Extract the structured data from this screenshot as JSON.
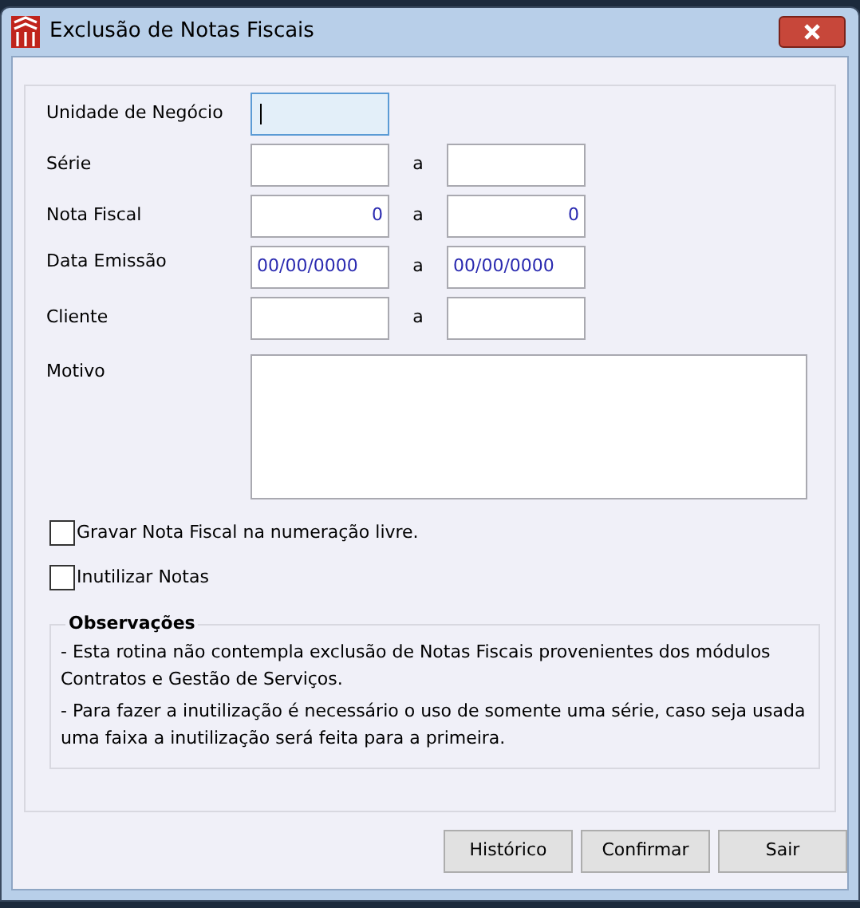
{
  "window": {
    "title": "Exclusão de Notas Fiscais"
  },
  "fields": [
    {
      "label": "Unidade de Negócio",
      "kind": "single",
      "focused": true
    },
    {
      "label": "Série",
      "kind": "range",
      "focused": false,
      "separator": "a"
    },
    {
      "label": "Nota Fiscal",
      "kind": "numeric",
      "focused": false,
      "from": "0",
      "separator": "a",
      "to": "0"
    },
    {
      "label": "Data Emissão",
      "kind": "date",
      "focused": false,
      "from": "00/00/0000",
      "separator": "a",
      "to": "00/00/0000"
    },
    {
      "label": "Cliente",
      "kind": "range",
      "focused": false,
      "separator": "a"
    }
  ],
  "motivo": {
    "label": "Motivo"
  },
  "checkboxes": [
    {
      "label": "Gravar Nota Fiscal na numeração livre.",
      "checked": false
    },
    {
      "label": "Inutilizar Notas",
      "checked": false
    }
  ],
  "notes": {
    "title": "Observações",
    "items": [
      "- Esta rotina não contempla exclusão de Notas Fiscais provenientes dos módulos Contratos e Gestão de Serviços.",
      "- Para fazer a inutilização é necessário o uso de somente uma série, caso seja usada uma faixa a inutilização será feita para a primeira."
    ]
  },
  "buttons": [
    "Histórico",
    "Confirmar",
    "Sair"
  ]
}
